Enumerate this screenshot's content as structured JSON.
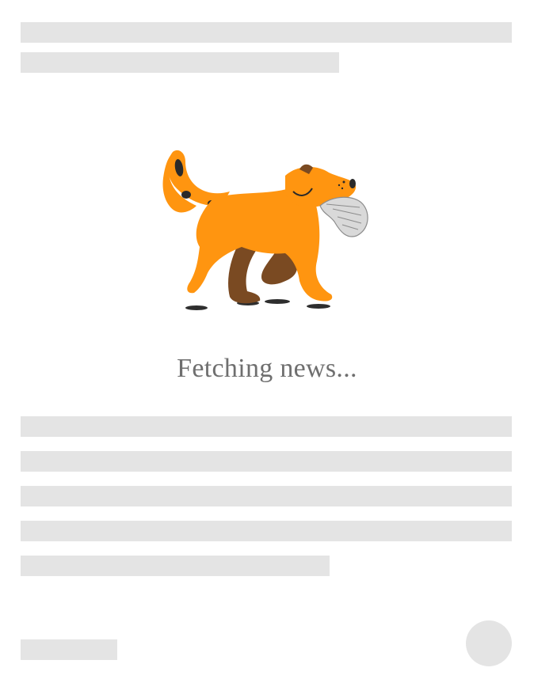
{
  "status": {
    "loading_text": "Fetching news..."
  },
  "illustration": {
    "icon": "dog-carrying-newspaper-icon",
    "colors": {
      "body": "#ff9510",
      "back_legs": "#7a4a22",
      "spots": "#2a2a2a",
      "newspaper": "#cfcfcf"
    }
  },
  "placeholder_color": "#e4e4e4"
}
